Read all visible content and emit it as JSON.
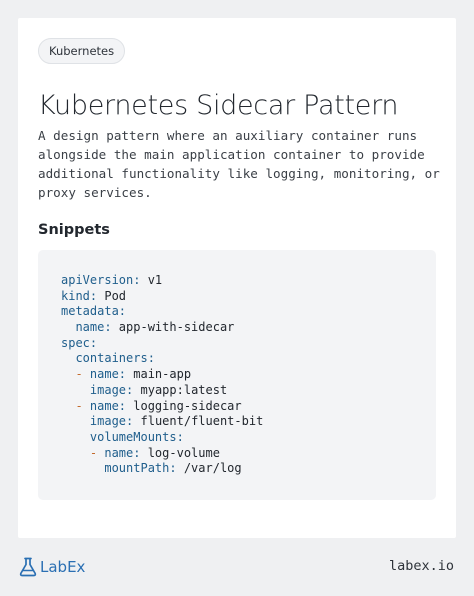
{
  "tag": "Kubernetes",
  "title": "Kubernetes Sidecar Pattern",
  "description": "A design pattern where an auxiliary container runs alongside the main application container to provide additional functionality like logging, monitoring, or proxy services.",
  "section_heading": "Snippets",
  "code_lines": [
    {
      "indent": "",
      "dash": "",
      "key": "apiVersion",
      "value": "v1"
    },
    {
      "indent": "",
      "dash": "",
      "key": "kind",
      "value": "Pod"
    },
    {
      "indent": "",
      "dash": "",
      "key": "metadata",
      "value": ""
    },
    {
      "indent": "  ",
      "dash": "",
      "key": "name",
      "value": "app-with-sidecar"
    },
    {
      "indent": "",
      "dash": "",
      "key": "spec",
      "value": ""
    },
    {
      "indent": "  ",
      "dash": "",
      "key": "containers",
      "value": ""
    },
    {
      "indent": "  ",
      "dash": "- ",
      "key": "name",
      "value": "main-app"
    },
    {
      "indent": "    ",
      "dash": "",
      "key": "image",
      "value": "myapp:latest"
    },
    {
      "indent": "  ",
      "dash": "- ",
      "key": "name",
      "value": "logging-sidecar"
    },
    {
      "indent": "    ",
      "dash": "",
      "key": "image",
      "value": "fluent/fluent-bit"
    },
    {
      "indent": "    ",
      "dash": "",
      "key": "volumeMounts",
      "value": ""
    },
    {
      "indent": "    ",
      "dash": "- ",
      "key": "name",
      "value": "log-volume"
    },
    {
      "indent": "      ",
      "dash": "",
      "key": "mountPath",
      "value": "/var/log"
    }
  ],
  "footer": {
    "brand": "LabEx",
    "url": "labex.io"
  },
  "colors": {
    "key": "#1f5e8c",
    "dash": "#c36b2d",
    "brand": "#2a6fb3"
  }
}
